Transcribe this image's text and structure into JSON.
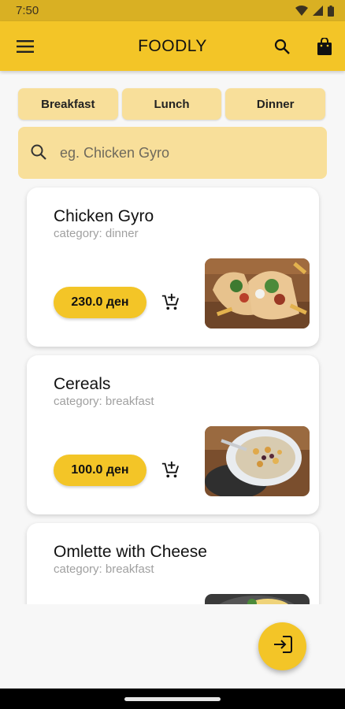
{
  "status_bar": {
    "time": "7:50",
    "icons": [
      "wifi-icon",
      "signal-icon",
      "battery-icon"
    ]
  },
  "app_bar": {
    "title": "FOODLY",
    "icons": [
      "menu-icon",
      "search-icon",
      "shopping-bag-icon"
    ]
  },
  "categories": [
    {
      "label": "Breakfast"
    },
    {
      "label": "Lunch"
    },
    {
      "label": "Dinner"
    }
  ],
  "search": {
    "placeholder": "eg. Chicken Gyro",
    "value": ""
  },
  "foods": [
    {
      "name": "Chicken Gyro",
      "category": "category: dinner",
      "price": "230.0 ден",
      "image": "chicken-gyro-photo"
    },
    {
      "name": "Cereals",
      "category": "category: breakfast",
      "price": "100.0 ден",
      "image": "cereals-photo"
    },
    {
      "name": "Omlette with Cheese",
      "category": "category: breakfast",
      "price": "",
      "image": "omelette-photo"
    }
  ],
  "fab": {
    "icon": "login-icon"
  },
  "colors": {
    "accent": "#f3c527",
    "accent_light": "#f8df9a",
    "status_bar": "#d9b023",
    "background": "#f7f7f7"
  }
}
